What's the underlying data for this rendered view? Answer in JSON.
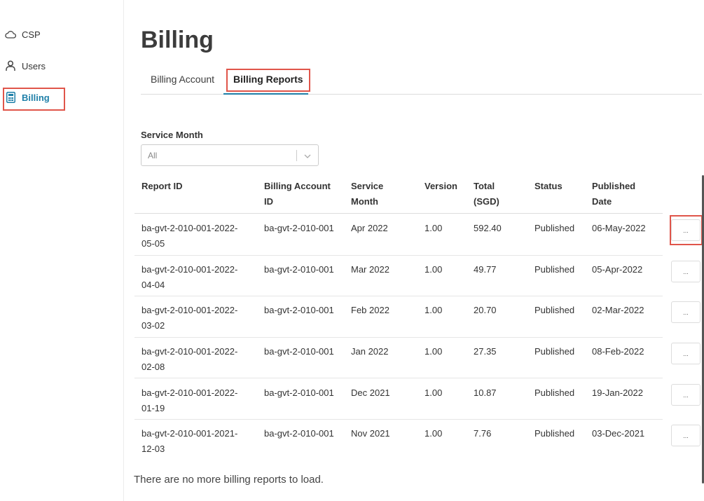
{
  "sidebar": {
    "items": [
      {
        "label": "CSP",
        "icon": "cloud-icon"
      },
      {
        "label": "Users",
        "icon": "user-icon"
      },
      {
        "label": "Billing",
        "icon": "calculator-icon",
        "active": true
      }
    ]
  },
  "page": {
    "title": "Billing"
  },
  "tabs": [
    {
      "label": "Billing Account"
    },
    {
      "label": "Billing Reports",
      "active": true
    }
  ],
  "filter": {
    "label": "Service Month",
    "value": "All"
  },
  "table": {
    "headers": {
      "report_id": "Report ID",
      "billing_account_id_1": "Billing Account",
      "billing_account_id_2": "ID",
      "service_month_1": "Service",
      "service_month_2": "Month",
      "version": "Version",
      "total_1": "Total",
      "total_2": "(SGD)",
      "status": "Status",
      "published_1": "Published",
      "published_2": "Date"
    },
    "rows": [
      {
        "report_id": "ba-gvt-2-010-001-2022-05-05",
        "billing_account_id": "ba-gvt-2-010-001",
        "service_month": "Apr 2022",
        "version": "1.00",
        "total": "592.40",
        "status": "Published",
        "published_date": "06-May-2022",
        "action": "..."
      },
      {
        "report_id": "ba-gvt-2-010-001-2022-04-04",
        "billing_account_id": "ba-gvt-2-010-001",
        "service_month": "Mar 2022",
        "version": "1.00",
        "total": "49.77",
        "status": "Published",
        "published_date": "05-Apr-2022",
        "action": "..."
      },
      {
        "report_id": "ba-gvt-2-010-001-2022-03-02",
        "billing_account_id": "ba-gvt-2-010-001",
        "service_month": "Feb 2022",
        "version": "1.00",
        "total": "20.70",
        "status": "Published",
        "published_date": "02-Mar-2022",
        "action": "..."
      },
      {
        "report_id": "ba-gvt-2-010-001-2022-02-08",
        "billing_account_id": "ba-gvt-2-010-001",
        "service_month": "Jan 2022",
        "version": "1.00",
        "total": "27.35",
        "status": "Published",
        "published_date": "08-Feb-2022",
        "action": "..."
      },
      {
        "report_id": "ba-gvt-2-010-001-2022-01-19",
        "billing_account_id": "ba-gvt-2-010-001",
        "service_month": "Dec 2021",
        "version": "1.00",
        "total": "10.87",
        "status": "Published",
        "published_date": "19-Jan-2022",
        "action": "..."
      },
      {
        "report_id": "ba-gvt-2-010-001-2021-12-03",
        "billing_account_id": "ba-gvt-2-010-001",
        "service_month": "Nov 2021",
        "version": "1.00",
        "total": "7.76",
        "status": "Published",
        "published_date": "03-Dec-2021",
        "action": "..."
      }
    ]
  },
  "footer": {
    "message": "There are no more billing reports to load."
  },
  "colors": {
    "accent": "#1e7fa8",
    "highlight": "#e0554a"
  }
}
